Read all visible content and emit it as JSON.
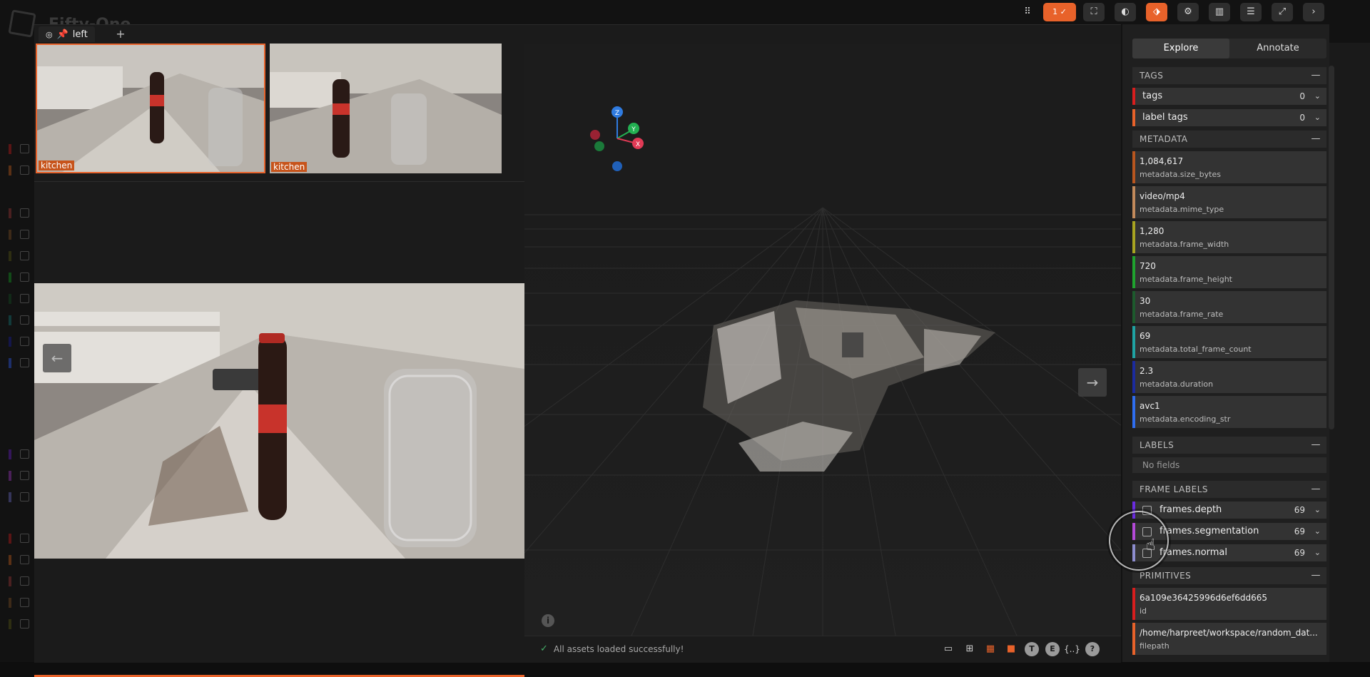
{
  "app": {
    "title": "Fifty-One"
  },
  "tab": {
    "label": "left",
    "add_label": "+"
  },
  "thumbnails": [
    {
      "label": "kitchen"
    },
    {
      "label": "kitchen"
    }
  ],
  "toolbar": {
    "selected_count": "1 ✓"
  },
  "sidebar": {
    "explore_label": "Explore",
    "annotate_label": "Annotate",
    "sections": {
      "tags": "TAGS",
      "metadata": "METADATA",
      "labels": "LABELS",
      "frame_labels": "FRAME LABELS",
      "primitives": "PRIMITIVES"
    },
    "tags": [
      {
        "name": "tags",
        "count": "0",
        "color": "#d81e1e"
      },
      {
        "name": "label tags",
        "count": "0",
        "color": "#e8622a"
      }
    ],
    "metadata": [
      {
        "value": "1,084,617",
        "key": "metadata.size_bytes",
        "color": "#b8561f"
      },
      {
        "value": "video/mp4",
        "key": "metadata.mime_type",
        "color": "#c28a5b"
      },
      {
        "value": "1,280",
        "key": "metadata.frame_width",
        "color": "#a8a421"
      },
      {
        "value": "720",
        "key": "metadata.frame_height",
        "color": "#1fa32e"
      },
      {
        "value": "30",
        "key": "metadata.frame_rate",
        "color": "#1d5a2d"
      },
      {
        "value": "69",
        "key": "metadata.total_frame_count",
        "color": "#1fa3a3"
      },
      {
        "value": "2.3",
        "key": "metadata.duration",
        "color": "#1b2b9e"
      },
      {
        "value": "avc1",
        "key": "metadata.encoding_str",
        "color": "#2f6ef0"
      }
    ],
    "labels_empty": "No fields",
    "frame_labels": [
      {
        "name": "frames.depth",
        "count": "69",
        "color": "#6a2ce0"
      },
      {
        "name": "frames.segmentation",
        "count": "69",
        "color": "#b44ad8"
      },
      {
        "name": "frames.normal",
        "count": "69",
        "color": "#8d8dcf"
      }
    ],
    "primitives": [
      {
        "value": "6a109e36425996d6ef6dd665",
        "key": "id",
        "color": "#d81e1e"
      },
      {
        "value": "/home/harpreet/workspace/random_dat...",
        "key": "filepath",
        "color": "#e8622a"
      }
    ]
  },
  "viewer": {
    "status": "All assets loaded successfully!",
    "axis_labels": {
      "z": "Z",
      "y": "Y",
      "x": "X"
    },
    "tool_t": "T",
    "tool_e": "E",
    "tool_json": "{..}",
    "tool_help": "?"
  }
}
